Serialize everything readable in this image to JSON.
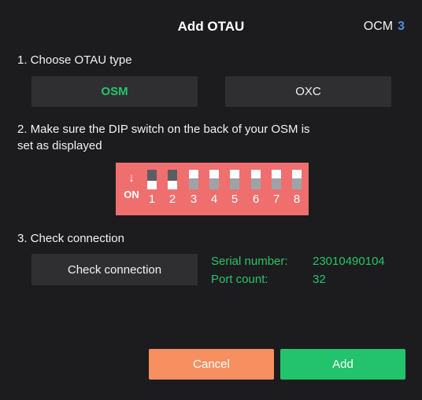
{
  "dialog": {
    "title": "Add OTAU",
    "ocm_label": "OCM",
    "ocm_number": "3"
  },
  "step1": {
    "label": "1. Choose OTAU type",
    "options": [
      {
        "label": "OSM",
        "selected": true
      },
      {
        "label": "OXC",
        "selected": false
      }
    ]
  },
  "step2": {
    "label_line1": "2. Make sure the DIP switch on the back of your OSM is",
    "label_line2": "set as displayed",
    "dip": {
      "arrow": "↓",
      "on_label": "ON",
      "switches": [
        {
          "number": "1",
          "on": true
        },
        {
          "number": "2",
          "on": true
        },
        {
          "number": "3",
          "on": false
        },
        {
          "number": "4",
          "on": false
        },
        {
          "number": "5",
          "on": false
        },
        {
          "number": "6",
          "on": false
        },
        {
          "number": "7",
          "on": false
        },
        {
          "number": "8",
          "on": false
        }
      ]
    }
  },
  "step3": {
    "label": "3. Check connection",
    "button_label": "Check connection",
    "serial_label": "Serial number:",
    "serial_value": "23010490104",
    "port_label": "Port count:",
    "port_value": "32"
  },
  "footer": {
    "cancel_label": "Cancel",
    "add_label": "Add"
  },
  "colors": {
    "accent_green": "#27c46a",
    "ocm_blue": "#4d8fe8",
    "dip_background": "#ef6f6f",
    "cancel_orange": "#f88f60",
    "add_green": "#23c26c"
  }
}
